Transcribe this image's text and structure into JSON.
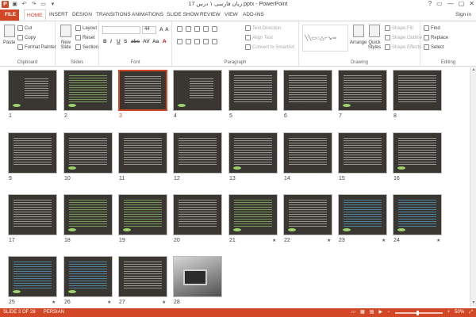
{
  "titlebar": {
    "title": "زبان فارسی ۱ درس 17.pptx - PowerPoint",
    "app_icon": "P",
    "qat": [
      "save-icon",
      "undo-icon",
      "redo-icon",
      "start-from-beginning-icon",
      "customize-icon"
    ],
    "controls": [
      "?",
      "▭",
      "—",
      "▢",
      "✕"
    ]
  },
  "tabs": {
    "file": "FILE",
    "items": [
      "HOME",
      "INSERT",
      "DESIGN",
      "TRANSITIONS",
      "ANIMATIONS",
      "SLIDE SHOW",
      "REVIEW",
      "VIEW",
      "ADD-INS"
    ],
    "active": "HOME",
    "signin": "Sign in"
  },
  "ribbon": {
    "clipboard": {
      "paste": "Paste",
      "cut": "Cut",
      "copy": "Copy",
      "format_painter": "Format Painter",
      "label": "Clipboard"
    },
    "slides": {
      "new_slide": "New Slide",
      "layout": "Layout",
      "reset": "Reset",
      "section": "Section",
      "label": "Slides"
    },
    "font": {
      "size": "44",
      "label": "Font",
      "buttons": [
        "B",
        "I",
        "U",
        "S",
        "abc",
        "AV",
        "Aa",
        "A"
      ]
    },
    "paragraph": {
      "text_direction": "Text Direction",
      "align_text": "Align Text",
      "convert_smartart": "Convert to SmartArt",
      "label": "Paragraph"
    },
    "drawing": {
      "arrange": "Arrange",
      "quick_styles": "Quick Styles",
      "shape_fill": "Shape Fill",
      "shape_outline": "Shape Outline",
      "shape_effects": "Shape Effects",
      "label": "Drawing"
    },
    "editing": {
      "find": "Find",
      "replace": "Replace",
      "select": "Select",
      "label": "Editing"
    }
  },
  "slides": [
    {
      "num": "1",
      "style": "sparse",
      "star": false
    },
    {
      "num": "2",
      "style": "green",
      "star": false
    },
    {
      "num": "3",
      "style": "plain",
      "star": false,
      "selected": true
    },
    {
      "num": "4",
      "style": "sparse",
      "star": false
    },
    {
      "num": "5",
      "style": "plain",
      "star": false
    },
    {
      "num": "6",
      "style": "plain",
      "star": false
    },
    {
      "num": "7",
      "style": "plain",
      "star": false
    },
    {
      "num": "8",
      "style": "plain",
      "star": false
    },
    {
      "num": "9",
      "style": "plain",
      "star": false
    },
    {
      "num": "10",
      "style": "plain",
      "star": false
    },
    {
      "num": "11",
      "style": "plain",
      "star": false
    },
    {
      "num": "12",
      "style": "plain",
      "star": false
    },
    {
      "num": "13",
      "style": "plain",
      "star": false
    },
    {
      "num": "14",
      "style": "plain",
      "star": false
    },
    {
      "num": "15",
      "style": "plain",
      "star": false
    },
    {
      "num": "16",
      "style": "plain",
      "star": false
    },
    {
      "num": "17",
      "style": "plain",
      "star": false
    },
    {
      "num": "18",
      "style": "green",
      "star": false
    },
    {
      "num": "19",
      "style": "green",
      "star": false
    },
    {
      "num": "20",
      "style": "plain",
      "star": false
    },
    {
      "num": "21",
      "style": "green",
      "star": true
    },
    {
      "num": "22",
      "style": "plain",
      "star": true
    },
    {
      "num": "23",
      "style": "blue",
      "star": true
    },
    {
      "num": "24",
      "style": "blue",
      "star": true
    },
    {
      "num": "25",
      "style": "blue",
      "star": true
    },
    {
      "num": "26",
      "style": "blue",
      "star": true
    },
    {
      "num": "27",
      "style": "plain",
      "star": true
    },
    {
      "num": "28",
      "style": "photo",
      "star": false
    }
  ],
  "star_glyph": "★",
  "statusbar": {
    "slide_indicator": "SLIDE 3 OF 28",
    "language": "PERSIAN",
    "zoom": "50%"
  },
  "colors": {
    "accent": "#d24726",
    "slide_bg": "#3a3632"
  }
}
